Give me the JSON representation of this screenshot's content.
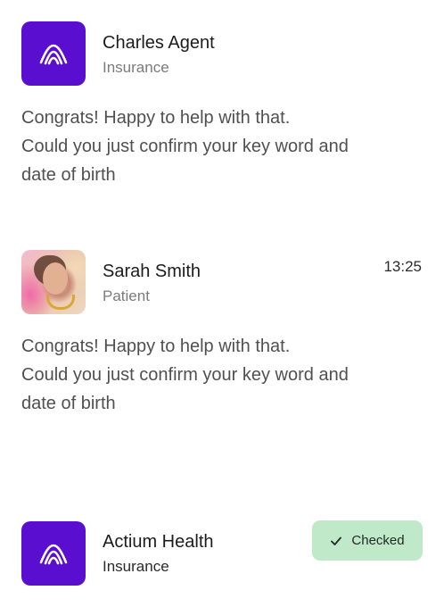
{
  "conversations": [
    {
      "name": "Charles Agent",
      "role": "Insurance",
      "avatar_icon": "brand-logo-icon",
      "message_lines": [
        "Congrats! Happy to help with that.",
        "Could you just confirm your key word and",
        "date of birth"
      ]
    },
    {
      "name": "Sarah Smith",
      "role": "Patient",
      "time": "13:25",
      "avatar_icon": "user-photo",
      "message_lines": [
        "Congrats! Happy to help with that.",
        "Could you just confirm your key word and",
        "date of birth"
      ]
    },
    {
      "name": "Actium Health",
      "role": "Insurance",
      "avatar_icon": "brand-logo-icon",
      "badge": {
        "label": "Checked",
        "icon": "check-icon",
        "color": "#bfe9c8"
      }
    }
  ],
  "colors": {
    "brand": "#5a0fd0",
    "text": "#1c1c1c",
    "muted": "#7b7b7b",
    "success_bg": "#bfe9c8"
  }
}
